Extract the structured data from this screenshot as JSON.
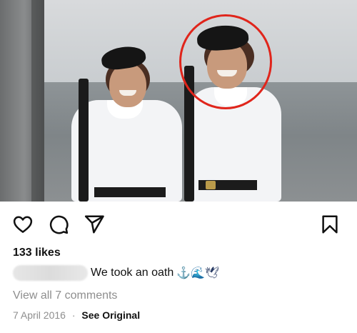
{
  "post": {
    "likes": "133 likes",
    "caption": "We took an oath",
    "caption_emojis": "⚓🌊🕊",
    "view_comments": "View all 7 comments",
    "date": "7 April 2016",
    "separator": "·",
    "see_original": "See Original"
  },
  "icons": {
    "like": "heart-icon",
    "comment": "comment-icon",
    "share": "send-icon",
    "save": "bookmark-icon"
  },
  "colors": {
    "highlight": "#e0251b",
    "muted_text": "#8e8e8e"
  }
}
